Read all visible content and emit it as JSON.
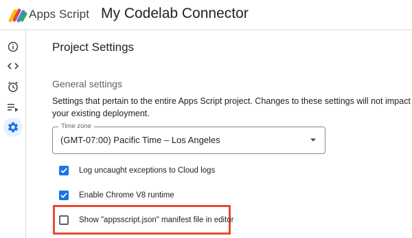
{
  "header": {
    "product_name": "Apps Script",
    "project_name": "My Codelab Connector"
  },
  "rail": {
    "items": [
      {
        "icon": "info-icon",
        "active": false
      },
      {
        "icon": "code-icon",
        "active": false
      },
      {
        "icon": "alarm-clock-icon",
        "active": false
      },
      {
        "icon": "executions-icon",
        "active": false
      },
      {
        "icon": "gear-icon",
        "active": true
      }
    ]
  },
  "main": {
    "page_title": "Project Settings",
    "section_title": "General settings",
    "section_description": "Settings that pertain to the entire Apps Script project. Changes to these settings will not impact your existing deployment.",
    "time_zone": {
      "label": "Time zone",
      "value": "(GMT-07:00) Pacific Time – Los Angeles"
    },
    "options": [
      {
        "label": "Log uncaught exceptions to Cloud logs",
        "checked": true
      },
      {
        "label": "Enable Chrome V8 runtime",
        "checked": true
      },
      {
        "label": "Show \"appsscript.json\" manifest file in editor",
        "checked": false
      }
    ]
  },
  "colors": {
    "accent": "#1a73e8",
    "highlight": "#e8492f",
    "active_rail_bg": "#e8f0fe"
  }
}
